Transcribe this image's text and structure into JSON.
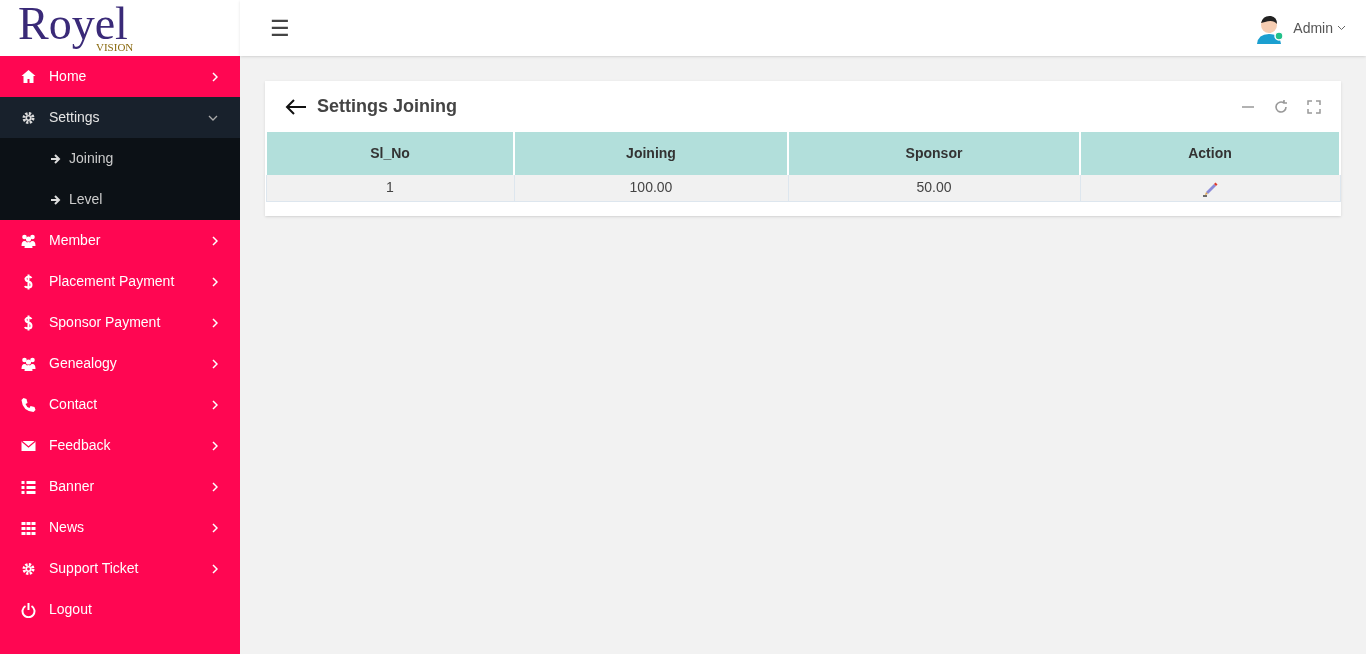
{
  "logo": {
    "name": "Royel",
    "tagline": "VISION"
  },
  "header": {
    "menu_icon": "☰",
    "user": "Admin"
  },
  "sidebar": {
    "items": [
      {
        "label": "Home",
        "expanded": false
      },
      {
        "label": "Settings",
        "expanded": true,
        "children": [
          {
            "label": "Joining"
          },
          {
            "label": "Level"
          }
        ]
      },
      {
        "label": "Member",
        "expanded": false
      },
      {
        "label": "Placement Payment",
        "expanded": false
      },
      {
        "label": "Sponsor Payment",
        "expanded": false
      },
      {
        "label": "Genealogy",
        "expanded": false
      },
      {
        "label": "Contact",
        "expanded": false
      },
      {
        "label": "Feedback",
        "expanded": false
      },
      {
        "label": "Banner",
        "expanded": false
      },
      {
        "label": "News",
        "expanded": false
      },
      {
        "label": "Support Ticket",
        "expanded": false
      },
      {
        "label": "Logout"
      }
    ]
  },
  "panel": {
    "title": "Settings Joining"
  },
  "table": {
    "columns": [
      "Sl_No",
      "Joining",
      "Sponsor",
      "Action"
    ],
    "rows": [
      [
        "1",
        "100.00",
        "50.00"
      ]
    ]
  }
}
